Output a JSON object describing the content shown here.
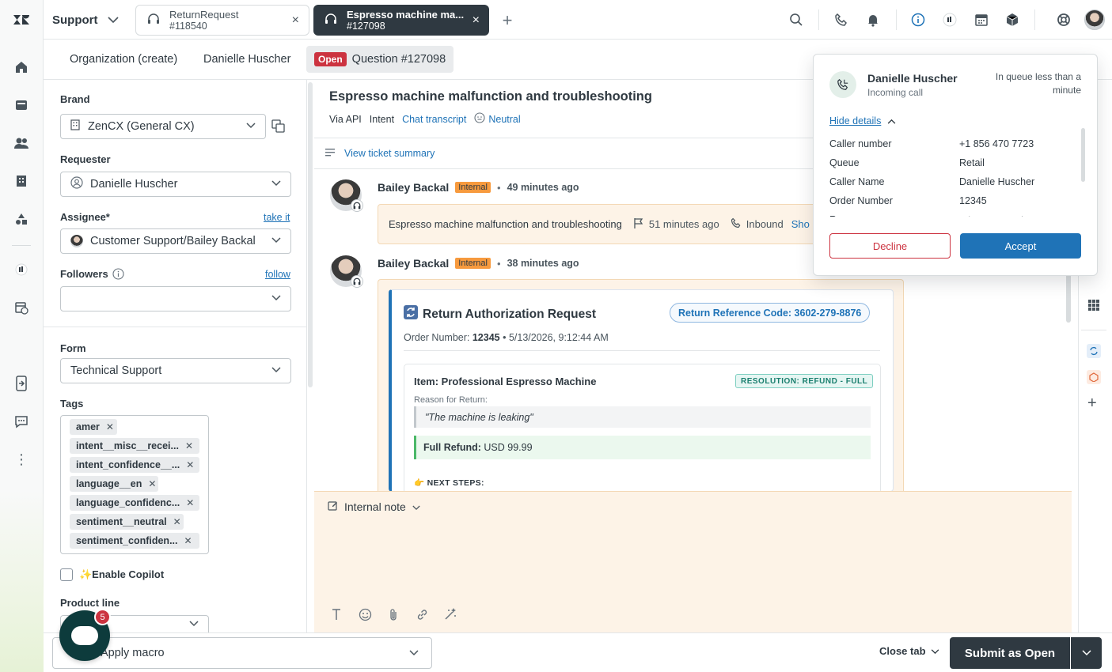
{
  "product": {
    "name": "Support"
  },
  "tabs": [
    {
      "title": "ReturnRequest",
      "subtitle": "#118540"
    },
    {
      "title": "Espresso machine ma...",
      "subtitle": "#127098"
    }
  ],
  "breadcrumbs": {
    "organization": "Organization (create)",
    "requester": "Danielle Huscher",
    "status": "Open",
    "ticket": "Question #127098"
  },
  "properties": {
    "brand_label": "Brand",
    "brand_value": "ZenCX (General CX)",
    "requester_label": "Requester",
    "requester_value": "Danielle Huscher",
    "assignee_label": "Assignee*",
    "assignee_link": "take it",
    "assignee_value": "Customer Support/Bailey Backal",
    "followers_label": "Followers",
    "followers_link": "follow",
    "form_label": "Form",
    "form_value": "Technical Support",
    "tags_label": "Tags",
    "tags": [
      "amer",
      "intent__misc__recei...",
      "intent_confidence__...",
      "language__en",
      "language_confidenc...",
      "sentiment__neutral",
      "sentiment_confiden..."
    ],
    "copilot_label": "✨Enable Copilot",
    "product_line_label": "Product line"
  },
  "ticket": {
    "title": "Espresso machine malfunction and troubleshooting",
    "via": "Via API",
    "intent_label": "Intent",
    "intent_value": "Chat transcript",
    "sentiment": "Neutral",
    "summary_link": "View ticket summary"
  },
  "events": [
    {
      "author": "Bailey Backal",
      "badge": "Internal",
      "ago": "49 minutes ago",
      "subject": "Espresso machine malfunction and troubleshooting",
      "time": "51 minutes ago",
      "direction": "Inbound",
      "more": "Sho"
    },
    {
      "author": "Bailey Backal",
      "badge": "Internal",
      "ago": "38 minutes ago"
    }
  ],
  "return_card": {
    "title": "Return Authorization Request",
    "reference": "Return Reference Code: 3602-279-8876",
    "order_label": "Order Number:",
    "order_number": "12345",
    "order_date": "• 5/13/2026, 9:12:44 AM",
    "item_title": "Item: Professional Espresso Machine",
    "resolution": "RESOLUTION: REFUND - FULL",
    "reason_label": "Reason for Return:",
    "reason_quote": "\"The machine is leaking\"",
    "refund_label": "Full Refund:",
    "refund_value": "USD 99.99",
    "next_steps": "👉 NEXT STEPS:"
  },
  "composer": {
    "mode": "Internal note"
  },
  "footer": {
    "macro_placeholder": "Apply macro",
    "close_tab": "Close tab",
    "submit": "Submit as Open"
  },
  "launcher": {
    "badge": "5"
  },
  "call": {
    "name": "Danielle Huscher",
    "status": "Incoming call",
    "queue_time": "In queue less than a minute",
    "hide_details": "Hide details",
    "details": [
      {
        "key": "Caller number",
        "value": "+1 856 470 7723"
      },
      {
        "key": "Queue",
        "value": "Retail"
      },
      {
        "key": "Caller Name",
        "value": "Danielle Huscher"
      },
      {
        "key": "Order Number",
        "value": "12345"
      },
      {
        "key": "Reason",
        "value": "return_request"
      }
    ],
    "decline": "Decline",
    "accept": "Accept"
  },
  "colors": {
    "primary": "#1f73b7",
    "danger": "#cc3340",
    "internal": "#f79a3e",
    "dark": "#2f3941",
    "note_bg": "#fdf3e7"
  }
}
